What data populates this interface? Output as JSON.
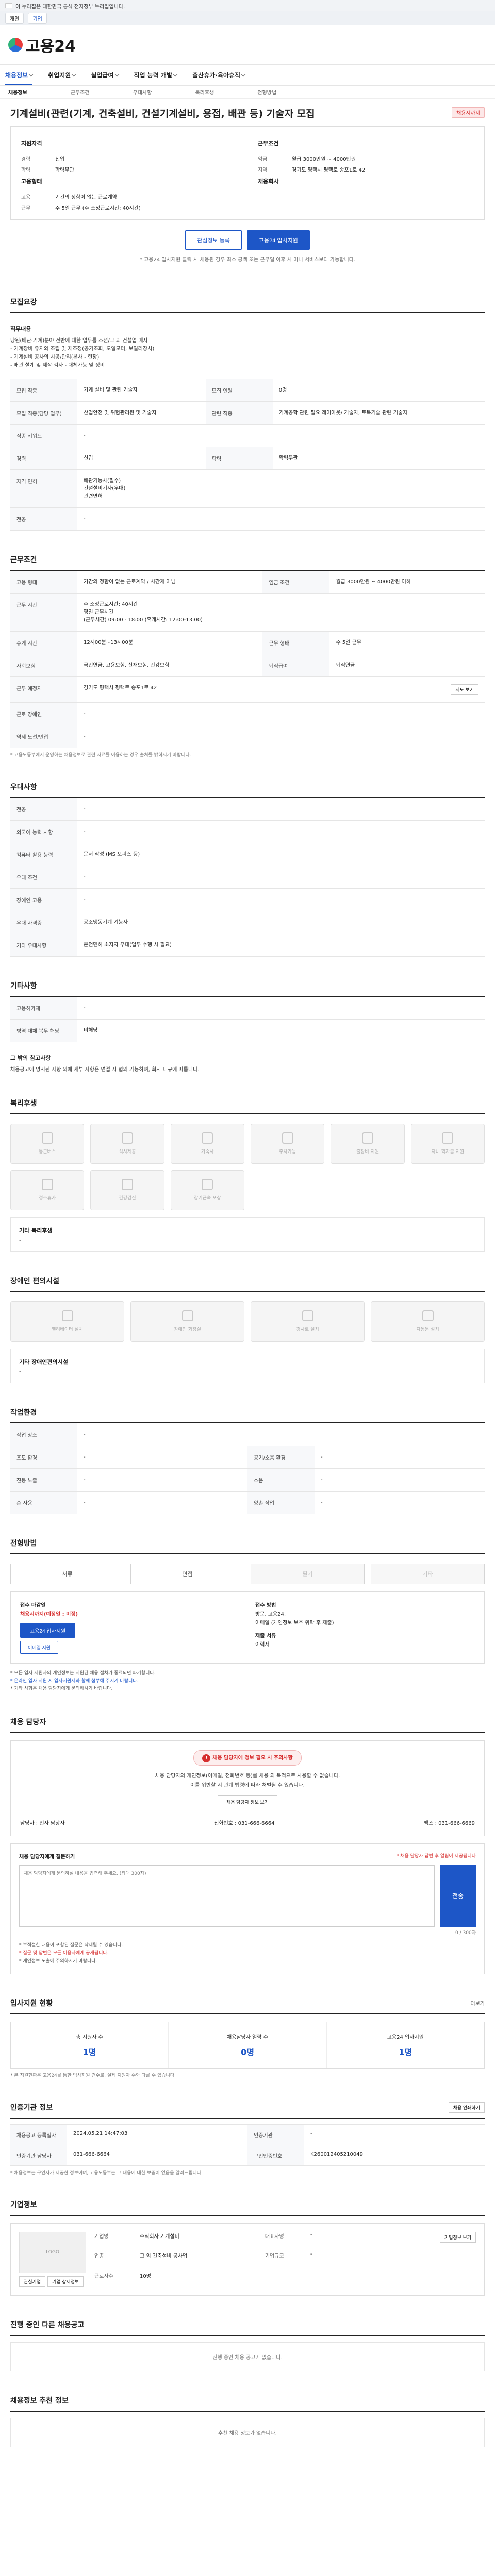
{
  "gov": {
    "banner_text": "이 누리집은 대한민국 공식 전자정부 누리집입니다.",
    "tabs": [
      "개인",
      "기업"
    ]
  },
  "header": {
    "logo_text": "고용24",
    "nav": [
      "채용정보",
      "취업지원",
      "실업급여",
      "직업 능력 개발",
      "출산휴가·육아휴직"
    ],
    "subnav": [
      "채용정보",
      "근무조건",
      "우대사항",
      "복리후생",
      "전형방법"
    ]
  },
  "job": {
    "title": "기계설비(관련(기계, 건축설비, 건설기계설비, 용접, 배관 등) 기술자 모집",
    "badge": "채용시까지",
    "left_heading": "지원자격",
    "left": [
      {
        "k": "경력",
        "v": "신입"
      },
      {
        "k": "학력",
        "v": "학력무관"
      }
    ],
    "left2_heading": "고용형태",
    "left2": [
      {
        "k": "고용",
        "v": "기간의 정함이 없는 근로계약"
      },
      {
        "k": "근무",
        "v": "주 5일 근무 (주 소정근로시간: 40시간)"
      }
    ],
    "right_heading": "근무조건",
    "right": [
      {
        "k": "임금",
        "v": "월급 3000만원 ~ 4000만원"
      },
      {
        "k": "지역",
        "v": "경기도 평택시 평택로 송포1로 42"
      }
    ],
    "right2_heading": "채용회사",
    "save_label": "관심정보 등록",
    "apply_label": "고용24 입사지원",
    "summary_note": "* 고용24 입사지원 클릭 시 채용된 경우 최소 공백 또는 근무일 이후 시 미니 서비스보다 가능합니다."
  },
  "recruit": {
    "section_title": "모집요강",
    "duty_label": "직무내용",
    "duty_text": "당원(배관·기계)분야 전반에 대한 업무를 조선/그 외 건설업 매사\n- 기계장비 유지와 조립 및 재조정(공기조화, 오일모터, 보일러장치)\n- 기계설비 공사의 시공/관리(본사 - 현장)\n- 배관 설계 및 제작·검사 - 대체가능 및 정비",
    "rows": [
      {
        "k": "모집 직종",
        "v": "기계 설비 및 관련 기술자",
        "k2": "모집 인원",
        "v2": "0명"
      },
      {
        "k": "모집 직종(담당 업무)",
        "v": "산업안전 및 위험관리원 및 기술자",
        "k2": "관련 직종",
        "v2": "기계공학 관련 필요 레이아웃/ 기술자, 토목기술 관련 기술자"
      },
      {
        "k": "직종 키워드",
        "v": "-",
        "k2": "",
        "v2": ""
      },
      {
        "k": "경력",
        "v": "신입",
        "k2": "학력",
        "v2": "학력무관"
      },
      {
        "k": "자격 면허",
        "v": "배관기능사(필수)\n건설설비기사(우대)\n관련면허",
        "k2": "",
        "v2": ""
      },
      {
        "k": "전공",
        "v": "-",
        "k2": "",
        "v2": ""
      }
    ]
  },
  "conditions": {
    "section_title": "근무조건",
    "rows": [
      {
        "k": "고용 형태",
        "v": "기간의 정함이 없는 근로계약 / 시간제 아님",
        "k2": "임금 조건",
        "v2": "월급 3000만원 ~ 4000만원 이하"
      },
      {
        "k": "근무 시간",
        "v": "주 소정근로시간: 40시간\n평일 근무시간\n(근무시간) 09:00 - 18:00 (휴게시간: 12:00-13:00)",
        "k2": "",
        "v2": ""
      },
      {
        "k": "휴게 시간",
        "v": "12시00분~13시00분",
        "k2": "근무 형태",
        "v2": "주 5일 근무"
      },
      {
        "k": "사회보험",
        "v": "국민연금, 고용보험, 산재보험, 건강보험",
        "k2": "퇴직급여",
        "v2": "퇴직연금"
      },
      {
        "k": "근무 예정지",
        "v": "경기도 평택시 평택로 송포1로 42",
        "k2": "",
        "v2": ""
      },
      {
        "k": "근로 장애인",
        "v": "-",
        "k2": "",
        "v2": ""
      },
      {
        "k": "역세 노선/인접",
        "v": "-",
        "k2": "",
        "v2": ""
      }
    ],
    "map_btn": "지도 보기",
    "note": "* 고용노동부에서 운영하는 채용정보로 관련 자료를 이용하는 경우 출처를 밝히시기 바랍니다."
  },
  "preferences": {
    "section_title": "우대사항",
    "rows": [
      {
        "k": "전공",
        "v": "-"
      },
      {
        "k": "외국어 능력 사항",
        "v": "-"
      },
      {
        "k": "컴퓨터 활용 능력",
        "v": "문서 작성 (MS 오피스 등)"
      },
      {
        "k": "우대 조건",
        "v": "-"
      },
      {
        "k": "장애인 고용",
        "v": "-"
      },
      {
        "k": "우대 자격증",
        "v": "공조냉동기계 기능사"
      },
      {
        "k": "기타 우대사항",
        "v": "운전면허 소지자 우대(업무 수행 시 필요)"
      }
    ]
  },
  "other": {
    "section_title": "기타사항",
    "rows": [
      {
        "k": "고용허가제",
        "v": "-"
      },
      {
        "k": "병역 대체 복무 해당",
        "v": "비해당"
      }
    ],
    "extra_label": "그 밖의 참고사항",
    "extra_text": "채용공고에 명시된 사항 외에 세부 사항은 면접 시 협의 가능하며, 회사 내규에 따릅니다."
  },
  "welfare": {
    "section_title": "복리후생",
    "items": [
      "통근버스",
      "식사제공",
      "기숙사",
      "주차가능",
      "출장비 지원",
      "자녀 학자금 지원",
      "경조휴가",
      "건강검진",
      "장기근속 포상"
    ],
    "other_label": "기타 복리후생",
    "other_value": "-"
  },
  "disability": {
    "section_title": "장애인 편의시설",
    "items": [
      "엘리베이터 설치",
      "장애인 화장실",
      "경사로 설치",
      "자동문 설치"
    ],
    "other_label": "기타 장애인편의시설",
    "other_value": "-"
  },
  "environment": {
    "section_title": "작업환경",
    "rows": [
      {
        "k": "작업 장소",
        "v": "-",
        "k2": "",
        "v2": ""
      },
      {
        "k": "조도 환경",
        "v": "-",
        "k2": "공기/소음 환경",
        "v2": "-"
      },
      {
        "k": "진동 노출",
        "v": "-",
        "k2": "소음",
        "v2": "-"
      },
      {
        "k": "손 사용",
        "v": "-",
        "k2": "양손 작업",
        "v2": "-"
      }
    ]
  },
  "selection": {
    "section_title": "전형방법",
    "tabs": [
      "서류",
      "면접",
      "필기",
      "기타"
    ],
    "period_label": "접수 마감일",
    "period_value": "채용시까지(예정일 : 미정)",
    "apply_btn": "고용24 입사지원",
    "email_btn": "이메일 지원",
    "method_label": "접수 방법",
    "method_value": "방문, 고용24,\n이메일 (개인정보 보호 위탁 후 제출)",
    "docs_label": "제출 서류",
    "docs_value": "이력서",
    "notes": [
      "* 모든 입사 지원자의 개인정보는 지원된 채용 절차가 종료되면 파기합니다.",
      "* 온라인 입사 지원 시 입사지원서와 함께 첨부해 주시기 바랍니다.",
      "* 기타 사항은 채용 담당자에게 문의하시기 바랍니다."
    ]
  },
  "contact": {
    "section_title": "채용 담당자",
    "alert": "채용 담당자에 정보 필요 시 주의사항",
    "text": "채용 담당자의 개인정보(이메일, 전화번호 등)를 채용 외 목적으로 사용할 수 없습니다.\n이를 위반할 시 관계 법령에 따라 처벌될 수 있습니다.",
    "btn": "채용 담당자 정보 보기",
    "name_label": "담당자",
    "name_value": "인사 담당자",
    "phone_label": "전화번호",
    "phone_value": "031-666-6664",
    "fax_label": "팩스",
    "fax_value": "031-666-6669"
  },
  "inquiry": {
    "title": "채용 담당자에게 질문하기",
    "sub": "* 채용 담당자 답변 후 알림이 제공됩니다",
    "placeholder": "채용 담당자에게 문의하실 내용을 입력해 주세요. (최대 300자)",
    "send": "전송",
    "count": "0 / 300자",
    "notes": [
      "* 부적절한 내용이 포함된 질문은 삭제될 수 있습니다.",
      "* 질문 및 답변은 모든 이용자에게 공개됩니다.",
      "* 개인정보 노출에 주의하시기 바랍니다."
    ]
  },
  "status": {
    "section_title": "입사지원 현황",
    "more": "더보기",
    "stats": [
      {
        "label": "총 지원자 수",
        "value": "1명"
      },
      {
        "label": "채용담당자 열람 수",
        "value": "0명"
      },
      {
        "label": "고용24 입사지원",
        "value": "1명"
      }
    ],
    "note": "* 본 지원현황은 고용24를 통한 입사지원 건수로, 실제 지원자 수와 다를 수 있습니다."
  },
  "apply_info": {
    "section_title": "인증기관 정보",
    "print": "채용 인쇄하기",
    "rows": [
      {
        "k": "채용공고 등록일자",
        "v": "2024.05.21 14:47:03",
        "k2": "인증기관",
        "v2": "-"
      },
      {
        "k": "인증기관 담당자",
        "v": "031-666-6664",
        "k2": "구인인증번호",
        "v2": "K260012405210049"
      }
    ],
    "note": "* 채용정보는 구인자가 제공한 정보이며, 고용노동부는 그 내용에 대한 보증이 없음을 알려드립니다."
  },
  "company": {
    "section_title": "기업정보",
    "logo_alt": "LOGO",
    "name_label": "기업명",
    "name_value": "주식회사 기계설비",
    "ceo_label": "대표자명",
    "ceo_value": "-",
    "industry_label": "업종",
    "industry_value": "그 외 건축설비 공사업",
    "size_label": "기업규모",
    "size_value": "-",
    "emp_label": "근로자수",
    "emp_value": "10명",
    "detail_btn": "기업정보 보기",
    "btn1": "관심기업",
    "btn2": "기업 상세정보"
  },
  "same_company": {
    "section_title": "진행 중인 다른 채용공고",
    "empty": "진행 중인 채용 공고가 없습니다."
  },
  "recommend": {
    "section_title": "채용정보 추천 정보",
    "empty": "추천 채용 정보가 없습니다."
  }
}
